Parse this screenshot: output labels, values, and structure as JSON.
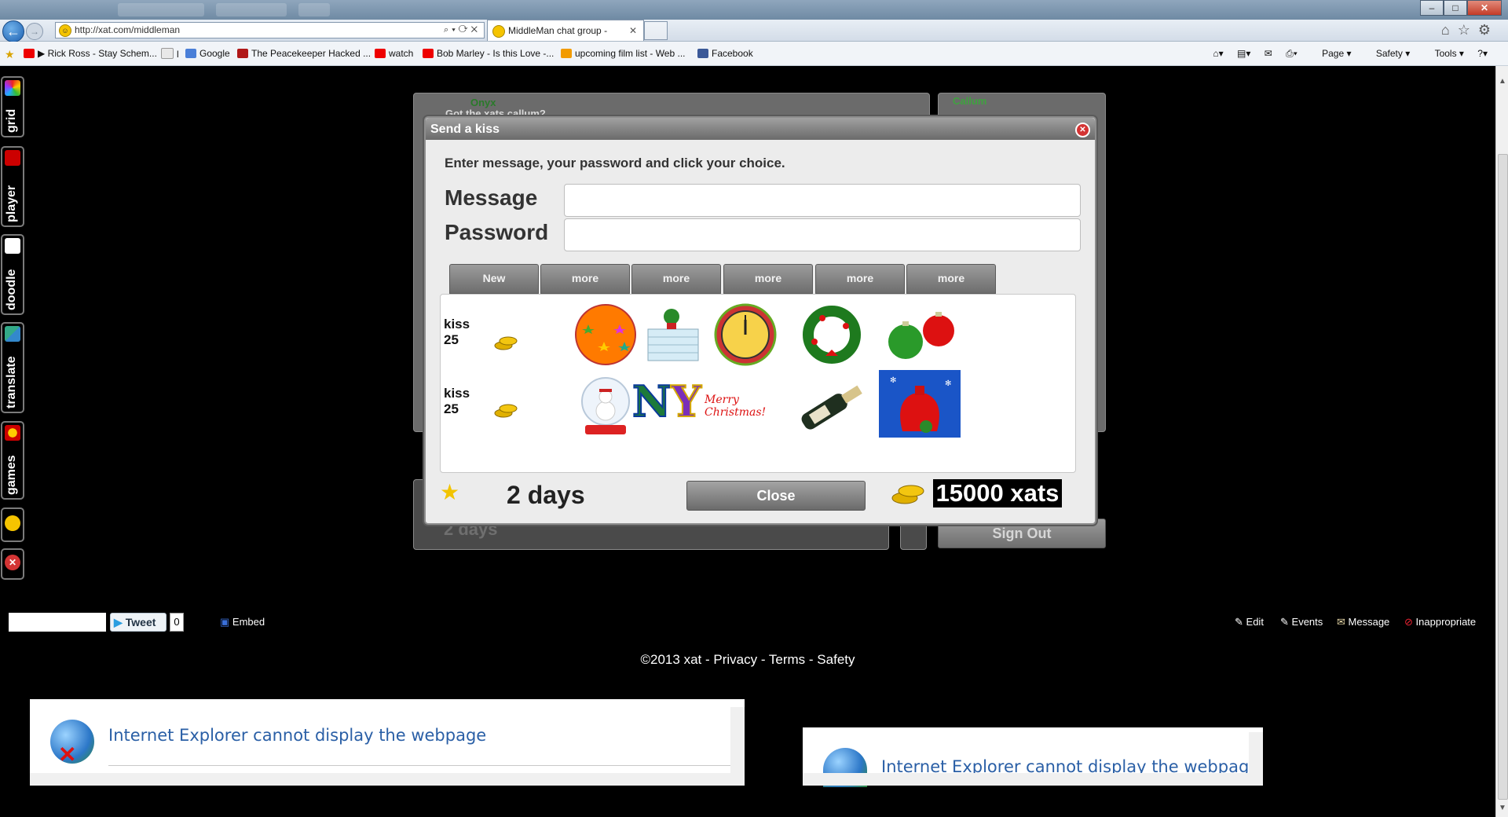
{
  "browser": {
    "address_url": "http://xat.com/middleman",
    "tab_title": "MiddleMan chat group -",
    "favorites": [
      "Rick Ross - Stay Schem...",
      "l",
      "Google",
      "The Peacekeeper Hacked ...",
      "watch",
      "Bob Marley - Is this Love -...",
      "upcoming film list - Web ...",
      "Facebook"
    ],
    "tools": {
      "page": "Page",
      "safety": "Safety",
      "tools": "Tools"
    }
  },
  "sidebar": {
    "items": [
      "grid",
      "player",
      "doodle",
      "translate",
      "games"
    ]
  },
  "chat": {
    "user1": "Onyx",
    "message1": "Got the xats callum?",
    "user_right": "Callum",
    "days_behind": "2 days",
    "xats_behind": "15000 xats",
    "sign_out": "Sign Out"
  },
  "dialog": {
    "title": "Send a kiss",
    "instructions": "Enter message, your password and click your choice.",
    "message_label": "Message",
    "password_label": "Password",
    "message_value": "",
    "password_value": "",
    "tabs": [
      "New",
      "more",
      "more",
      "more",
      "more",
      "more"
    ],
    "rows": [
      {
        "label_line1": "kiss",
        "label_line2": "25",
        "gifts": [
          "star-ball",
          "igloo",
          "new-year-clock",
          "wreath",
          "baubles"
        ]
      },
      {
        "label_line1": "kiss",
        "label_line2": "25",
        "gifts": [
          "snow-globe",
          "NY",
          "Merry Christmas!",
          "champagne",
          "santa-sack"
        ]
      }
    ],
    "ny_text_n": "N",
    "ny_text_y": "Y",
    "merry_text": "Merry Christmas!",
    "days": "2 days",
    "close_label": "Close",
    "xats": "15000 xats"
  },
  "footer": {
    "tweet": "Tweet",
    "tweet_count": "0",
    "embed": "Embed",
    "edit": "Edit",
    "events": "Events",
    "message": "Message",
    "inappropriate": "Inappropriate",
    "copyright_prefix": "©2013 xat - ",
    "privacy": "Privacy",
    "terms": "Terms",
    "safety": "Safety",
    "sep": " - "
  },
  "ie_error": {
    "text": "Internet Explorer cannot display the webpage"
  },
  "colors": {
    "accent_gold": "#f2c400",
    "link_blue": "#2a5fa6",
    "dialog_bg": "#ececec"
  }
}
